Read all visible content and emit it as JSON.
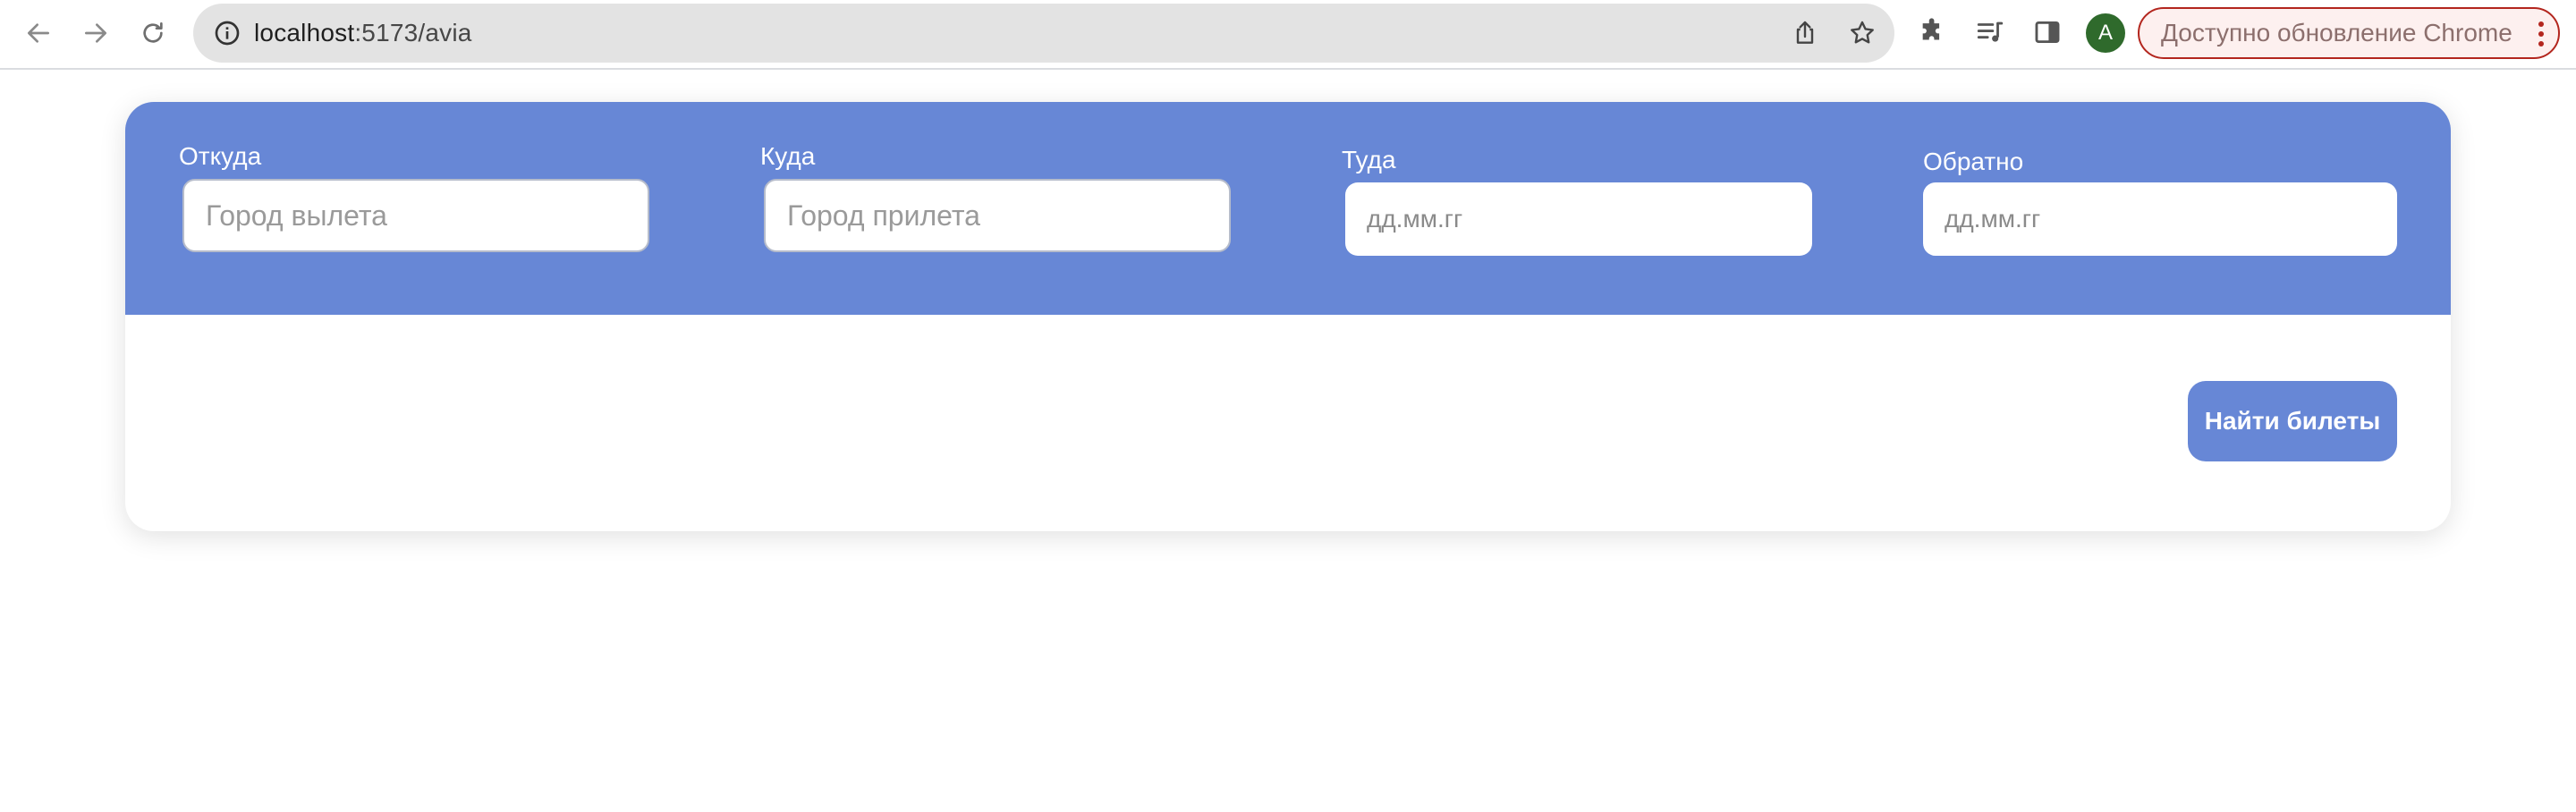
{
  "browser": {
    "url_host": "localhost",
    "url_path": ":5173/avia",
    "avatar_letter": "A",
    "update_label": "Доступно обновление Chrome"
  },
  "search": {
    "from": {
      "label": "Откуда",
      "placeholder": "Город вылета"
    },
    "to": {
      "label": "Куда",
      "placeholder": "Город прилета"
    },
    "depart": {
      "label": "Туда",
      "placeholder": "дд.мм.гг"
    },
    "return": {
      "label": "Обратно",
      "placeholder": "дд.мм.гг"
    },
    "submit_label": "Найти билеты"
  },
  "colors": {
    "accent": "#6787d6",
    "avatar": "#2f6a2c",
    "update_border": "#b3261e"
  }
}
